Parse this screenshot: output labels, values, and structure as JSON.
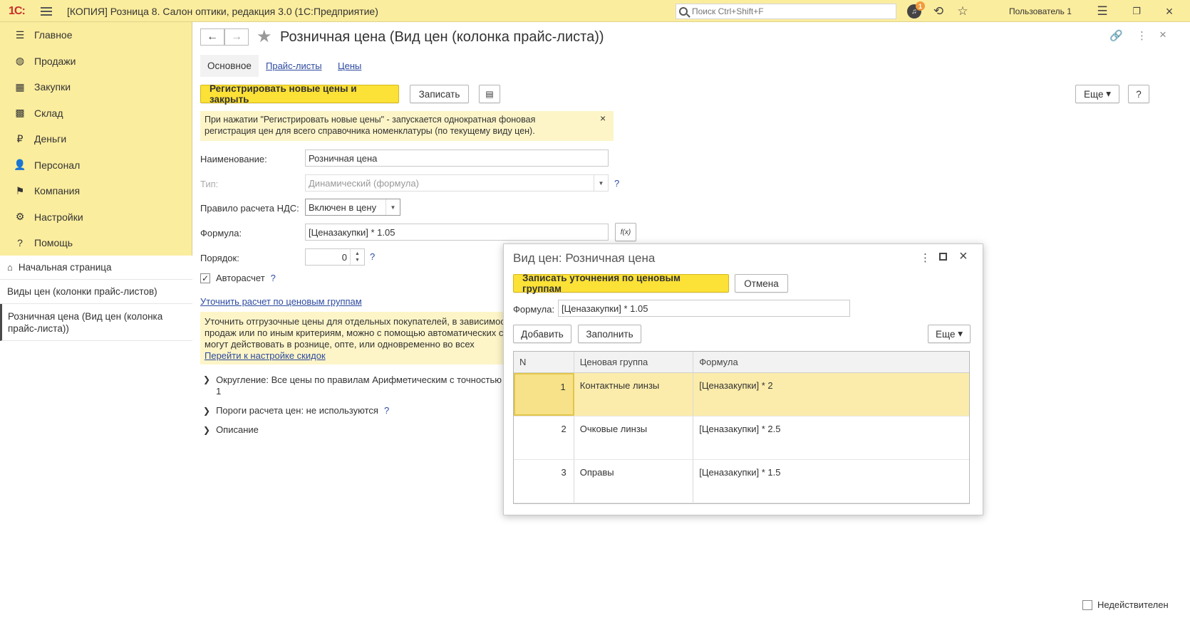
{
  "titlebar": {
    "logo": "1С:",
    "title": "[КОПИЯ] Розница 8. Салон оптики, редакция 3.0  (1С:Предприятие)",
    "search_placeholder": "Поиск Ctrl+Shift+F",
    "notification_count": "1",
    "user": "Пользователь 1"
  },
  "sidebar": {
    "items": [
      {
        "label": "Главное",
        "icon": "☰"
      },
      {
        "label": "Продажи",
        "icon": "◍"
      },
      {
        "label": "Закупки",
        "icon": "▦"
      },
      {
        "label": "Склад",
        "icon": "▩"
      },
      {
        "label": "Деньги",
        "icon": "₽"
      },
      {
        "label": "Персонал",
        "icon": "👤"
      },
      {
        "label": "Компания",
        "icon": "⚑"
      },
      {
        "label": "Настройки",
        "icon": "⚙"
      },
      {
        "label": "Помощь",
        "icon": "?"
      }
    ],
    "open": {
      "home": "Начальная страница",
      "list": "Виды цен (колонки прайс-листов)",
      "active": "Розничная цена (Вид цен (колонка прайс-листа))"
    }
  },
  "form": {
    "title": "Розничная цена (Вид цен (колонка прайс-листа))",
    "tabs": [
      "Основное",
      "Прайс-листы",
      "Цены"
    ],
    "register_button": "Регистрировать новые цены и закрыть",
    "save_button": "Записать",
    "more_button": "Еще",
    "help_button": "?",
    "info_text": "При нажатии \"Регистрировать новые цены\" - запускается однократная фоновая регистрация цен для всего справочника номенклатуры (по текущему виду цен).",
    "name_label": "Наименование:",
    "name_value": "Розничная цена",
    "type_label": "Тип:",
    "type_value": "Динамический (формула)",
    "vat_label": "Правило расчета НДС:",
    "vat_value": "Включен в цену",
    "formula_label": "Формула:",
    "formula_value": "[Ценазакупки] * 1.05",
    "order_label": "Порядок:",
    "order_value": "0",
    "autocalc_label": "Авторасчет",
    "refine_link": "Уточнить расчет по ценовым группам",
    "shipping_text": "Уточнить отгрузочные цены для отдельных покупателей, в зависимост продаж или по иным критериям, можно с помощью автоматических ск могут действовать в рознице, опте, или одновременно во всех каналах",
    "discount_link": "Перейти к настройке скидок",
    "rounding": "Округление: Все цены по правилам Арифметическим с точностью 1",
    "thresholds": "Пороги расчета цен: не используются",
    "description": "Описание",
    "inactive_label": "Недействителен"
  },
  "dialog": {
    "title": "Вид цен: Розничная цена",
    "save_button": "Записать уточнения по ценовым группам",
    "cancel_button": "Отмена",
    "formula_label": "Формула:",
    "formula_value": "[Ценазакупки] * 1.05",
    "add_button": "Добавить",
    "fill_button": "Заполнить",
    "more_button": "Еще",
    "columns": [
      "N",
      "Ценовая группа",
      "Формула"
    ],
    "rows": [
      {
        "n": "1",
        "group": "Контактные линзы",
        "formula": "[Ценазакупки] * 2"
      },
      {
        "n": "2",
        "group": "Очковые линзы",
        "formula": "[Ценазакупки] * 2.5"
      },
      {
        "n": "3",
        "group": "Оправы",
        "formula": "[Ценазакупки] * 1.5"
      }
    ]
  }
}
